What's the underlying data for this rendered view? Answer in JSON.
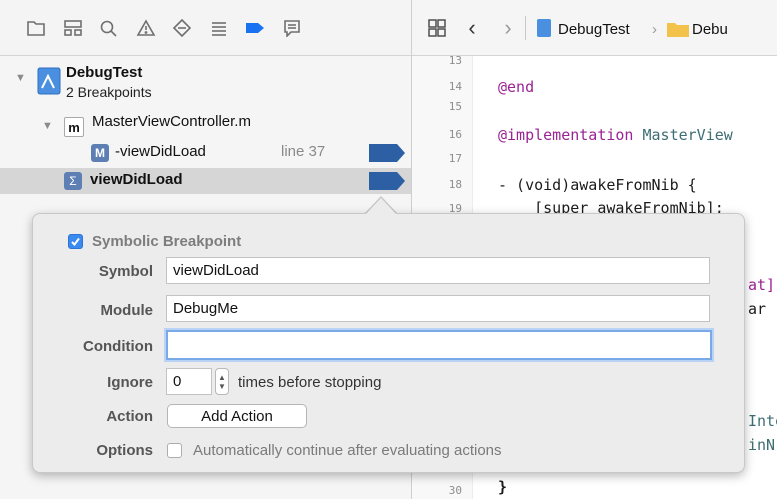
{
  "navigator": {
    "toolbar_icons": [
      "folder-icon",
      "hierarchy-icon",
      "search-icon",
      "warning-icon",
      "test-diamond-icon",
      "debug-list-icon",
      "breakpoint-icon",
      "report-icon"
    ],
    "project": {
      "name": "DebugTest",
      "subtitle": "2 Breakpoints"
    },
    "file": {
      "icon_letter": "m",
      "name": "MasterViewController.m"
    },
    "breakpoints": [
      {
        "badge": "M",
        "label": "-viewDidLoad",
        "line": "line 37"
      },
      {
        "badge": "Σ",
        "label": "viewDidLoad"
      }
    ],
    "colors": {
      "accent": "#1a72f0",
      "breakpoint": "#2c5fa3",
      "selected_row": "#d6d6d6"
    }
  },
  "editor": {
    "breadcrumbs": [
      "DebugTest",
      "Debu"
    ],
    "lines": [
      {
        "num": "13",
        "code": ""
      },
      {
        "num": "14",
        "code": "@end"
      },
      {
        "num": "15",
        "code": ""
      },
      {
        "num": "16",
        "code": "@implementation MasterView"
      },
      {
        "num": "17",
        "code": ""
      },
      {
        "num": "18",
        "code": "- (void)awakeFromNib {"
      },
      {
        "num": "19",
        "code": "    [super awakeFromNib];"
      },
      {
        "num": "30",
        "code": "}"
      }
    ],
    "right_fragments": [
      "at]",
      "ar '",
      "Inte",
      "inN"
    ]
  },
  "popover": {
    "enabled": true,
    "title": "Symbolic Breakpoint",
    "symbol_label": "Symbol",
    "symbol_value": "viewDidLoad",
    "module_label": "Module",
    "module_value": "DebugMe",
    "condition_label": "Condition",
    "condition_value": "",
    "ignore_label": "Ignore",
    "ignore_value": "0",
    "ignore_suffix": "times before stopping",
    "action_label": "Action",
    "action_button": "Add Action",
    "options_label": "Options",
    "options_text": "Automatically continue after evaluating actions",
    "auto_continue": false
  }
}
